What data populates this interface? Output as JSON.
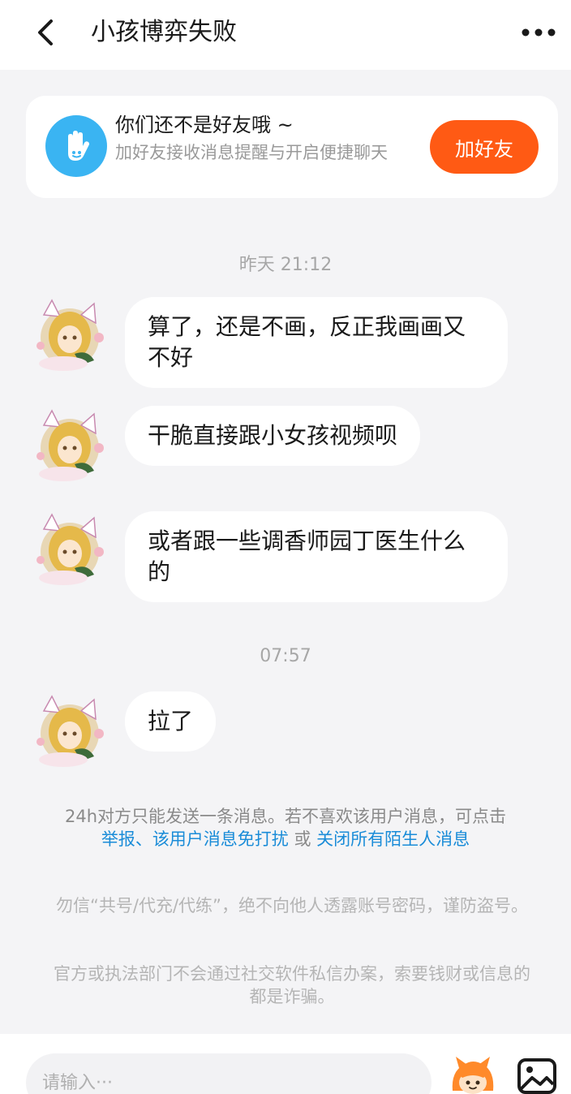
{
  "header": {
    "title": "小孩博弈失败",
    "back_icon": "chevron-left-icon",
    "more_icon": "more-dots-icon"
  },
  "friend_card": {
    "icon": "hand-wave-icon",
    "title": "你们还不是好友哦 ~",
    "description": "加好友接收消息提醒与开启便捷聊天",
    "add_button": "加好友",
    "colors": {
      "button": "#ff5a14",
      "icon_bg": "#3ab4f2"
    }
  },
  "messages": [
    {
      "timestamp": "昨天 21:12"
    },
    {
      "text": "算了，还是不画，反正我画画又不好"
    },
    {
      "text": "干脆直接跟小女孩视频呗"
    },
    {
      "text": "或者跟一些调香师园丁医生什么的"
    },
    {
      "timestamp": "07:57"
    },
    {
      "text": "拉了"
    }
  ],
  "notice": {
    "text": "24h对方只能发送一条消息。若不喜欢该用户消息，可点击",
    "link_report": "举报",
    "separator": "、",
    "link_mute": "该用户消息免打扰",
    "or": " 或 ",
    "link_close": "关闭所有陌生人消息"
  },
  "warnings": [
    "勿信“共号/代充/代练”，绝不向他人透露账号密码，谨防盗号。",
    "官方或执法部门不会通过社交软件私信办案，索要钱财或信息的都是诈骗。"
  ],
  "input": {
    "placeholder": "请输入···",
    "emoji_icon": "character-emoji-icon",
    "image_icon": "image-icon"
  }
}
